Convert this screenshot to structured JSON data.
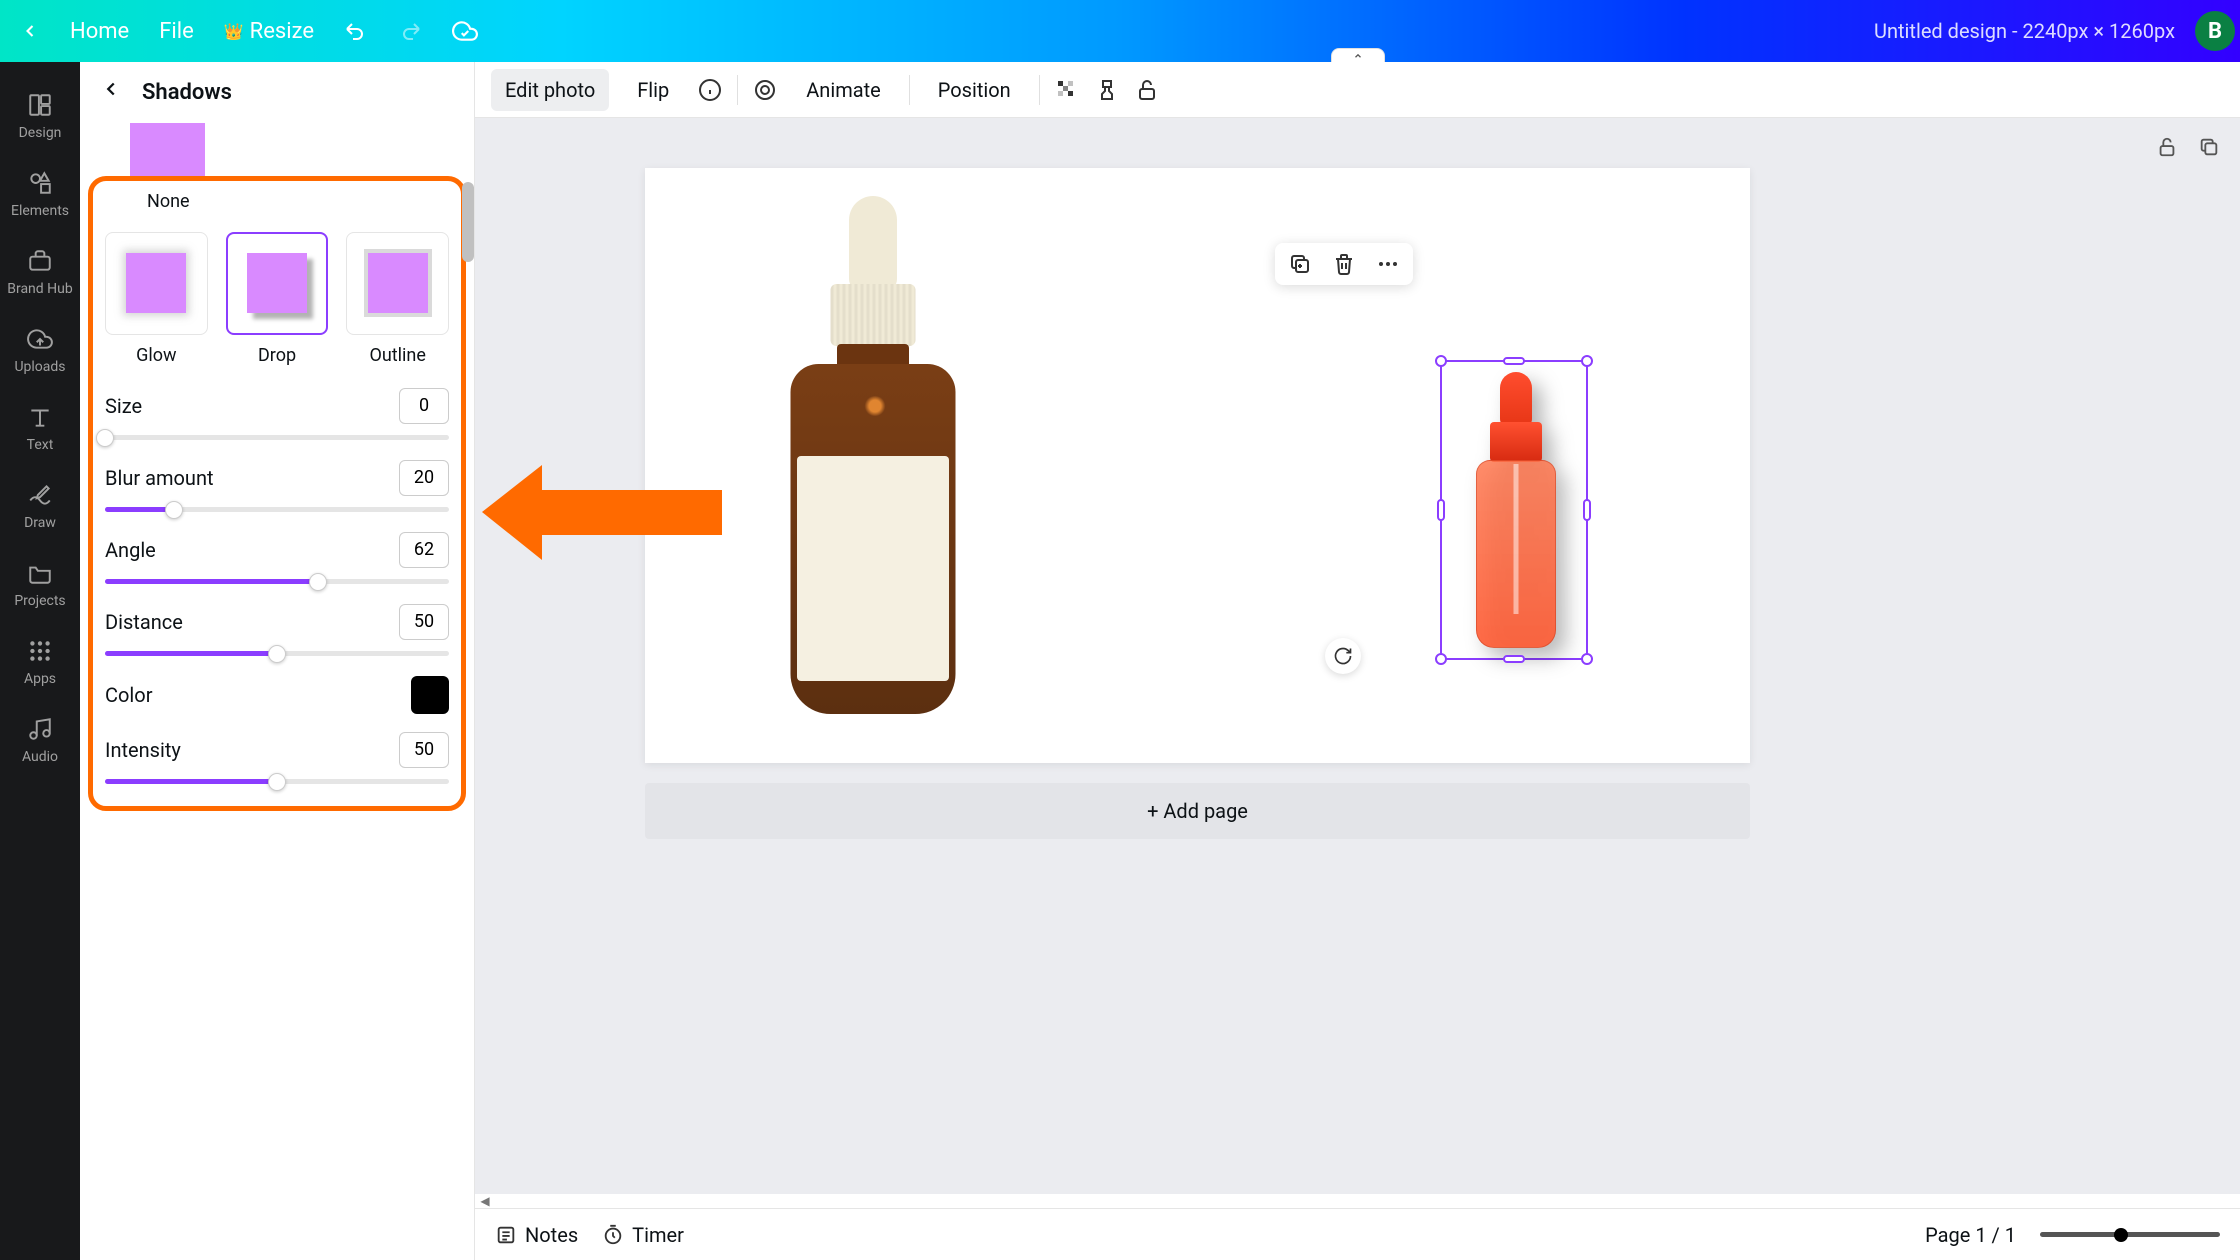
{
  "topbar": {
    "home": "Home",
    "file": "File",
    "resize": "Resize",
    "doc_title": "Untitled design - 2240px × 1260px",
    "avatar_initial": "B"
  },
  "rail": {
    "items": [
      {
        "label": "Design"
      },
      {
        "label": "Elements"
      },
      {
        "label": "Brand Hub"
      },
      {
        "label": "Uploads"
      },
      {
        "label": "Text"
      },
      {
        "label": "Draw"
      },
      {
        "label": "Projects"
      },
      {
        "label": "Apps"
      },
      {
        "label": "Audio"
      }
    ]
  },
  "panel": {
    "title": "Shadows",
    "none_label": "None",
    "shadow_options": [
      {
        "label": "Glow"
      },
      {
        "label": "Drop"
      },
      {
        "label": "Outline"
      }
    ],
    "controls": {
      "size": {
        "label": "Size",
        "value": "0",
        "percent": 0
      },
      "blur": {
        "label": "Blur amount",
        "value": "20",
        "percent": 20
      },
      "angle": {
        "label": "Angle",
        "value": "62",
        "percent": 62
      },
      "distance": {
        "label": "Distance",
        "value": "50",
        "percent": 50
      },
      "color": {
        "label": "Color",
        "hex": "#000000"
      },
      "intensity": {
        "label": "Intensity",
        "value": "50",
        "percent": 50
      }
    }
  },
  "canvas_toolbar": {
    "edit_photo": "Edit photo",
    "flip": "Flip",
    "animate": "Animate",
    "position": "Position"
  },
  "canvas": {
    "add_page": "+ Add page"
  },
  "footer": {
    "notes": "Notes",
    "timer": "Timer",
    "page_indicator": "Page 1 / 1"
  }
}
